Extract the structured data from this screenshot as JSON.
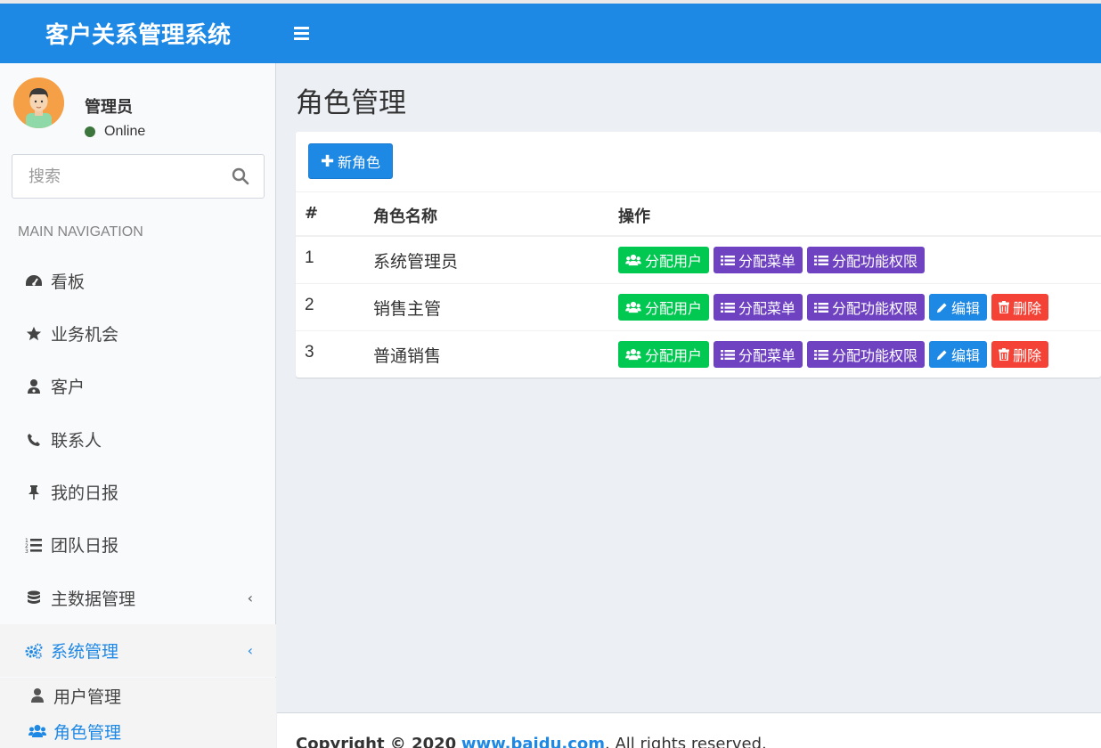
{
  "header": {
    "brand": "客户关系管理系统"
  },
  "user": {
    "name": "管理员",
    "status": "Online"
  },
  "search": {
    "placeholder": "搜索"
  },
  "sidebar": {
    "nav_header": "MAIN NAVIGATION",
    "items": [
      {
        "label": "看板",
        "icon": "dashboard-icon"
      },
      {
        "label": "业务机会",
        "icon": "star-icon"
      },
      {
        "label": "客户",
        "icon": "user-md-icon"
      },
      {
        "label": "联系人",
        "icon": "phone-icon"
      },
      {
        "label": "我的日报",
        "icon": "thumbtack-icon"
      },
      {
        "label": "团队日报",
        "icon": "list-ol-icon"
      },
      {
        "label": "主数据管理",
        "icon": "database-icon"
      },
      {
        "label": "系统管理",
        "icon": "cogs-icon"
      }
    ],
    "sub_items": [
      {
        "label": "用户管理",
        "icon": "user-icon"
      },
      {
        "label": "角色管理",
        "icon": "users-icon"
      }
    ]
  },
  "main": {
    "title": "角色管理",
    "new_button": "新角色",
    "columns": [
      "#",
      "角色名称",
      "操作"
    ],
    "rows": [
      {
        "num": "1",
        "name": "系统管理员",
        "actions": [
          "分配用户",
          "分配菜单",
          "分配功能权限"
        ]
      },
      {
        "num": "2",
        "name": "销售主管",
        "actions": [
          "分配用户",
          "分配菜单",
          "分配功能权限",
          "编辑",
          "删除"
        ]
      },
      {
        "num": "3",
        "name": "普通销售",
        "actions": [
          "分配用户",
          "分配菜单",
          "分配功能权限",
          "编辑",
          "删除"
        ]
      }
    ]
  },
  "footer": {
    "copyright": "Copyright © 2020",
    "link_text": "www.baidu.com",
    "suffix": ". All rights reserved."
  },
  "colors": {
    "primary": "#1e88e5",
    "green": "#00c851",
    "purple": "#6f42c1",
    "red": "#f44336",
    "online": "#3c763d"
  }
}
